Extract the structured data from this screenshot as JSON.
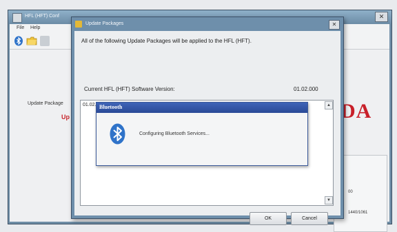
{
  "main_window": {
    "title": "HFL (HFT) Conf",
    "menu": [
      "File",
      "Help"
    ],
    "side_label": "Update Package",
    "side_red_text": "Up",
    "brand": "DA",
    "info_lines": [
      "00",
      "1440/1061"
    ]
  },
  "update_dialog": {
    "title": "Update Packages",
    "message": "All of the following Update Packages will be applied to the HFL (HFT).",
    "version_label": "Current HFL (HFT) Software Version:",
    "version_value": "01.02.000",
    "list_items": [
      "01.02.000_[TC]_01.05.000.update"
    ],
    "ok_label": "OK",
    "cancel_label": "Cancel"
  },
  "bluetooth_popup": {
    "title": "Bluetooth",
    "message": "Configuring Bluetooth Services..."
  },
  "colors": {
    "title_blue": "#3f64b7",
    "bluetooth_icon": "#2f73c9",
    "honda_red": "#c8202a"
  },
  "icons": [
    "bluetooth-icon",
    "folder-icon",
    "close-icon",
    "scroll-up-icon",
    "scroll-down-icon"
  ]
}
